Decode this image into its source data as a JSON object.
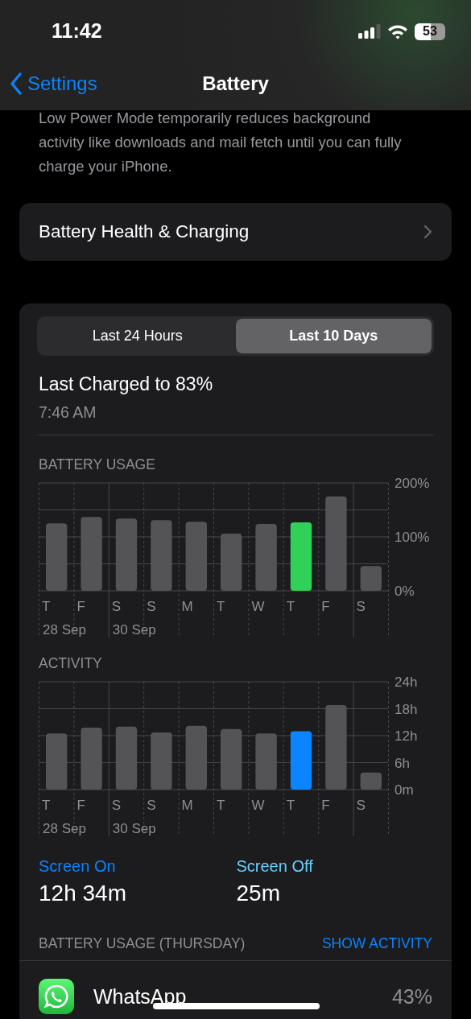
{
  "status_bar": {
    "time": "11:42",
    "battery": "53"
  },
  "nav": {
    "back": "Settings",
    "title": "Battery"
  },
  "low_power_note": "Low Power Mode temporarily reduces background activity like downloads and mail fetch until you can fully charge your iPhone.",
  "health_row": {
    "label": "Battery Health & Charging"
  },
  "range_tabs": [
    {
      "label": "Last 24 Hours",
      "selected": false
    },
    {
      "label": "Last 10 Days",
      "selected": true
    }
  ],
  "last_charged": {
    "title": "Last Charged to 83%",
    "time": "7:46 AM"
  },
  "charts": [
    {
      "chart_data": {
        "type": "bar",
        "title": "BATTERY USAGE",
        "categories": [
          "T",
          "F",
          "S",
          "S",
          "M",
          "T",
          "W",
          "T",
          "F",
          "S"
        ],
        "grid": true,
        "ylim": [
          0,
          200
        ],
        "yticks": [
          {
            "value": 0,
            "label": "0%"
          },
          {
            "value": 100,
            "label": "100%"
          },
          {
            "value": 200,
            "label": "200%"
          }
        ],
        "series": [
          {
            "color": "#545456",
            "values": [
              125,
              137,
              134,
              131,
              128,
              106,
              124,
              null,
              175,
              46
            ]
          },
          {
            "color": "#30d158",
            "values": [
              null,
              null,
              null,
              null,
              null,
              null,
              null,
              127,
              null,
              null
            ]
          }
        ]
      },
      "date_labels": [
        "28 Sep",
        "30 Sep"
      ]
    },
    {
      "chart_data": {
        "type": "bar",
        "title": "ACTIVITY",
        "categories": [
          "T",
          "F",
          "S",
          "S",
          "M",
          "T",
          "W",
          "T",
          "F",
          "S"
        ],
        "grid": true,
        "ylim": [
          0,
          24
        ],
        "yticks": [
          {
            "value": 0,
            "label": "0m"
          },
          {
            "value": 6,
            "label": "6h"
          },
          {
            "value": 12,
            "label": "12h"
          },
          {
            "value": 18,
            "label": "18h"
          },
          {
            "value": 24,
            "label": "24h"
          }
        ],
        "series": [
          {
            "color": "#545456",
            "values": [
              12.5,
              13.8,
              14,
              12.7,
              14.2,
              13.5,
              12.5,
              null,
              18.8,
              3.8
            ]
          },
          {
            "color": "#0a84ff",
            "values": [
              null,
              null,
              null,
              null,
              null,
              null,
              null,
              13,
              null,
              null
            ]
          }
        ]
      },
      "date_labels": [
        "28 Sep",
        "30 Sep"
      ]
    }
  ],
  "screen_stats": [
    {
      "label": "Screen On",
      "value": "12h 34m",
      "color": "#0a84ff"
    },
    {
      "label": "Screen Off",
      "value": "25m",
      "color": "#64d2ff"
    }
  ],
  "usage_section": {
    "title": "BATTERY USAGE (THURSDAY)",
    "action": "SHOW ACTIVITY"
  },
  "apps": [
    {
      "name": "WhatsApp",
      "share": "43%"
    }
  ]
}
